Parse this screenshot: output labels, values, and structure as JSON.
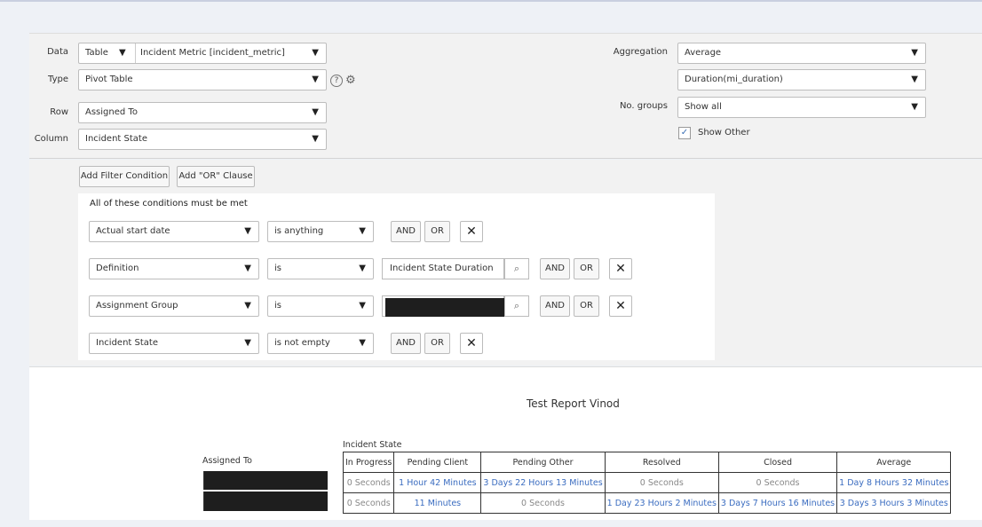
{
  "config": {
    "data_label": "Data",
    "data_source": "Table",
    "data_table": "Incident Metric [incident_metric]",
    "type_label": "Type",
    "type_value": "Pivot Table",
    "row_label": "Row",
    "row_value": "Assigned To",
    "column_label": "Column",
    "column_value": "Incident State",
    "aggregation_label": "Aggregation",
    "aggregation_value": "Average",
    "aggregation_field": "Duration(mi_duration)",
    "groups_label": "No. groups",
    "groups_value": "Show all",
    "show_other_label": "Show Other",
    "show_other_checked": true
  },
  "filter": {
    "add_condition": "Add Filter Condition",
    "add_or": "Add \"OR\" Clause",
    "title": "All of these conditions must be met",
    "and_label": "AND",
    "or_label": "OR",
    "conditions": [
      {
        "field": "Actual start date",
        "operator": "is anything",
        "value": ""
      },
      {
        "field": "Definition",
        "operator": "is",
        "value": "Incident State Duration"
      },
      {
        "field": "Assignment Group",
        "operator": "is",
        "value": "[redacted]"
      },
      {
        "field": "Incident State",
        "operator": "is not empty",
        "value": ""
      }
    ]
  },
  "report": {
    "title": "Test Report Vinod",
    "column_group_label": "Incident State",
    "row_group_label": "Assigned To",
    "columns": [
      "In Progress",
      "Pending Client",
      "Pending Other",
      "Resolved",
      "Closed",
      "Average"
    ],
    "rows": [
      {
        "assignee": "[redacted]",
        "cells": [
          "0 Seconds",
          "1 Hour 42 Minutes",
          "3 Days 22 Hours 13 Minutes",
          "0 Seconds",
          "0 Seconds",
          "1 Day 8 Hours 32 Minutes"
        ]
      },
      {
        "assignee": "[redacted]",
        "cells": [
          "0 Seconds",
          "11 Minutes",
          "0 Seconds",
          "1 Day 23 Hours 2 Minutes",
          "3 Days 7 Hours 16 Minutes",
          "3 Days 3 Hours 3 Minutes"
        ]
      }
    ]
  },
  "colors": {
    "link": "#3a6cc0",
    "zero": "#888888",
    "panel": "#f2f2f2"
  }
}
